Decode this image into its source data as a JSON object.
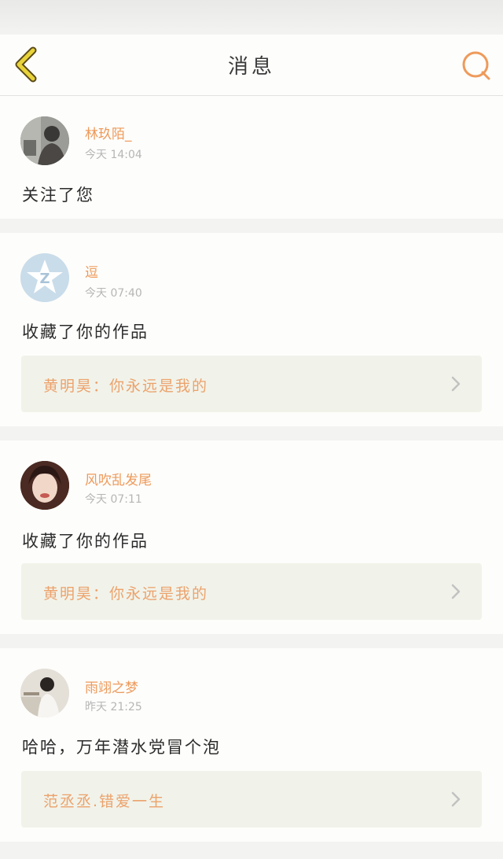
{
  "header": {
    "title": "消息"
  },
  "notifications": [
    {
      "username": "林玖陌_",
      "time": "今天 14:04",
      "message": "关注了您"
    },
    {
      "username": "逗",
      "time": "今天 07:40",
      "message": "收藏了你的作品",
      "work": "黄明昊：你永远是我的"
    },
    {
      "username": "风吹乱发尾",
      "time": "今天 07:11",
      "message": "收藏了你的作品",
      "work": "黄明昊：你永远是我的"
    },
    {
      "username": "雨翊之梦",
      "time": "昨天 21:25",
      "message": "哈哈，万年潜水党冒个泡",
      "work": "范丞丞.错爱一生"
    }
  ],
  "colors": {
    "accent": "#ee9a5b",
    "back_icon": "#e8d33a",
    "reference_bg": "#f1f3ea"
  }
}
